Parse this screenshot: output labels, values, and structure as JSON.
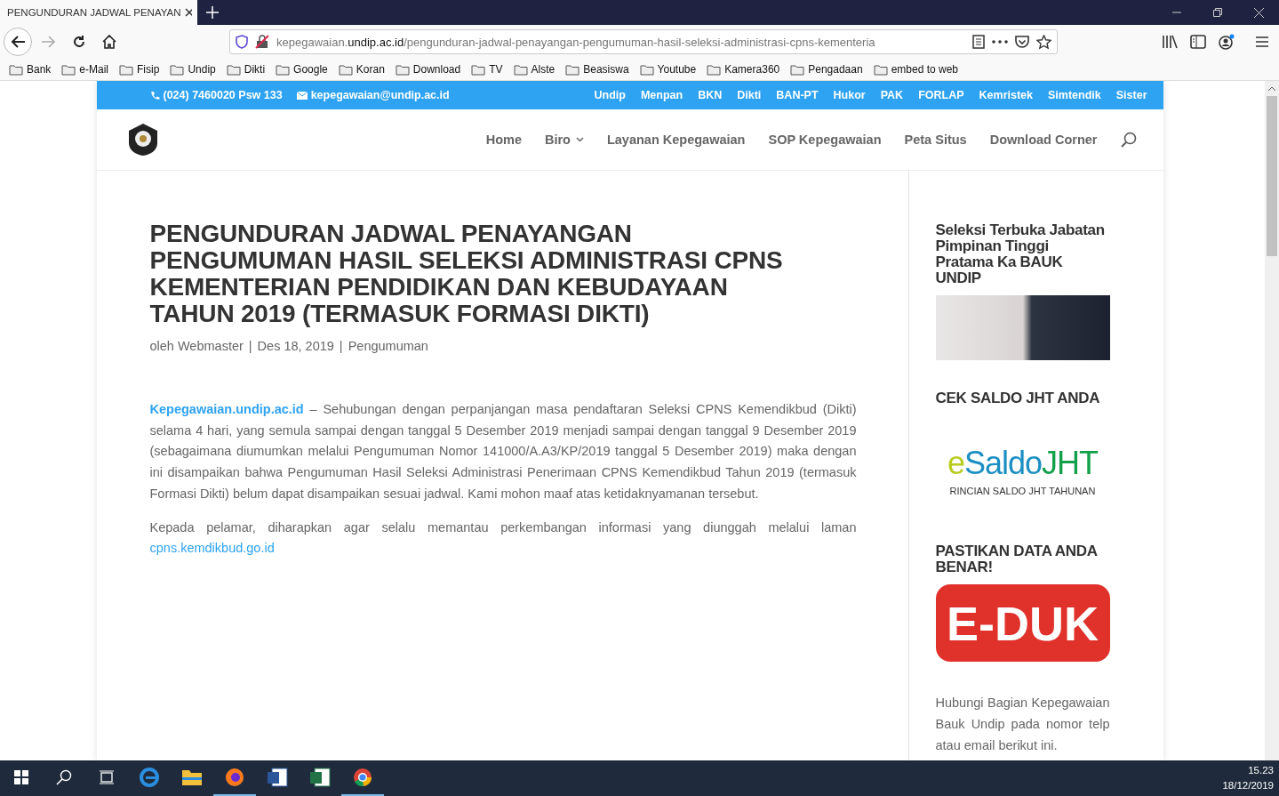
{
  "browser": {
    "tabs": [
      {
        "title": "PENGUNDURAN JADWAL PENAYAN",
        "selected": true
      }
    ],
    "url": {
      "subdomain": "kepegawaian.",
      "domain": "undip.ac.id",
      "path": "/pengunduran-jadwal-penayangan-pengumuman-hasil-seleksi-administrasi-cpns-kementeria"
    },
    "bookmarks": [
      "Bank",
      "e-Mail",
      "Fisip",
      "Undip",
      "Dikti",
      "Google",
      "Koran",
      "Download",
      "TV",
      "Alste",
      "Beasiswa",
      "Youtube",
      "Kamera360",
      "Pengadaan",
      "embed to web"
    ]
  },
  "site": {
    "topbar": {
      "phone": "(024) 7460020 Psw 133",
      "email": "kepegawaian@undip.ac.id",
      "links": [
        "Undip",
        "Menpan",
        "BKN",
        "Dikti",
        "BAN-PT",
        "Hukor",
        "PAK",
        "FORLAP",
        "Kemristek",
        "Simtendik",
        "Sister"
      ]
    },
    "nav": [
      {
        "label": "Home",
        "dropdown": false
      },
      {
        "label": "Biro",
        "dropdown": true
      },
      {
        "label": "Layanan Kepegawaian",
        "dropdown": false
      },
      {
        "label": "SOP Kepegawaian",
        "dropdown": false
      },
      {
        "label": "Peta Situs",
        "dropdown": false
      },
      {
        "label": "Download Corner",
        "dropdown": false
      }
    ],
    "article": {
      "title": "PENGUNDURAN JADWAL PENAYANGAN PENGUMUMAN HASIL SELEKSI ADMINISTRASI CPNS KEMENTERIAN PENDIDIKAN DAN KEBUDAYAAN TAHUN 2019 (TERMASUK FORMASI DIKTI)",
      "meta": [
        "oleh Webmaster",
        "Des 18, 2019",
        "Pengumuman"
      ],
      "meta_separator": "|",
      "paragraphs": [
        [
          {
            "kind": "bold-link",
            "text": "Kepegawaian.undip.ac.id"
          },
          {
            "kind": "text",
            "text": " – Sehubungan dengan perpanjangan masa pendaftaran Seleksi CPNS Kemendikbud (Dikti) selama 4 hari, yang semula sampai dengan tanggal 5 Desember 2019 menjadi sampai dengan tanggal 9 Desember 2019 (sebagaimana diumumkan melalui Pengumuman Nomor 141000/A.A3/KP/2019 tanggal 5 Desember 2019) maka dengan ini disampaikan bahwa Pengumuman Hasil Seleksi Administrasi Penerimaan CPNS Kemendikbud Tahun 2019 (termasuk Formasi Dikti) belum dapat disampaikan sesuai jadwal. Kami mohon maaf atas ketidaknyamanan tersebut."
          }
        ],
        [
          {
            "kind": "text",
            "text": "Kepada pelamar, diharapkan agar selalu memantau perkembangan informasi yang diunggah melalui laman "
          },
          {
            "kind": "link",
            "text": "cpns.kemdikbud.go.id"
          }
        ]
      ]
    },
    "sidebar": [
      {
        "kind": "photo",
        "title": "Seleksi Terbuka Jabatan Pimpinan Tinggi Pratama Ka BAUK UNDIP"
      },
      {
        "kind": "logo",
        "title": "CEK SALDO JHT ANDA",
        "logo": [
          "e",
          "Saldo",
          "JHT"
        ],
        "tagline": "RINCIAN SALDO JHT TAHUNAN"
      },
      {
        "kind": "badge",
        "title": "PASTIKAN DATA ANDA BENAR!",
        "label": "E-DUK"
      },
      {
        "kind": "text",
        "text": "Hubungi Bagian Kepegawaian Bauk Undip pada nomor telp atau email berikut ini."
      }
    ]
  },
  "taskbar": {
    "apps": [
      {
        "kind": "edge",
        "running": false
      },
      {
        "kind": "explorer",
        "running": false
      },
      {
        "kind": "firefox",
        "running": true
      },
      {
        "kind": "word",
        "running": false
      },
      {
        "kind": "excel",
        "running": false
      },
      {
        "kind": "chrome",
        "running": true
      }
    ],
    "time": "15.23",
    "date": "18/12/2019"
  }
}
